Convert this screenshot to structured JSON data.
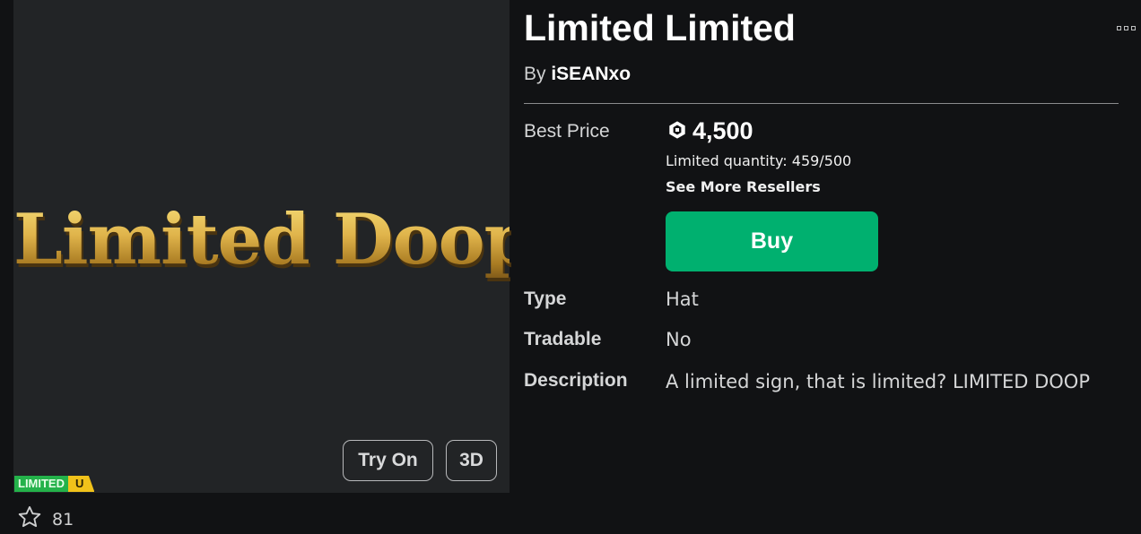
{
  "item": {
    "title": "Limited Limited",
    "by_prefix": "By ",
    "creator": "iSEANxo",
    "thumbnail_text": "Limited Doop"
  },
  "thumbnail": {
    "try_on_label": "Try On",
    "three_d_label": "3D",
    "badge_limited": "LIMITED",
    "badge_u": "U",
    "favorites_count": "81"
  },
  "pricing": {
    "best_price_label": "Best Price",
    "price": "4,500",
    "currency_icon": "robux-icon",
    "limited_quantity": "Limited quantity: 459/500",
    "see_more_resellers": "See More Resellers",
    "buy_label": "Buy"
  },
  "details": {
    "type_label": "Type",
    "type_value": "Hat",
    "tradable_label": "Tradable",
    "tradable_value": "No",
    "description_label": "Description",
    "description_value": "A limited sign, that is limited? LIMITED DOOP"
  },
  "colors": {
    "background": "#111214",
    "thumbnail_bg": "#222426",
    "buy_green": "#00b06f",
    "limited_green": "#24b24a",
    "limited_yellow": "#f1c21a"
  }
}
